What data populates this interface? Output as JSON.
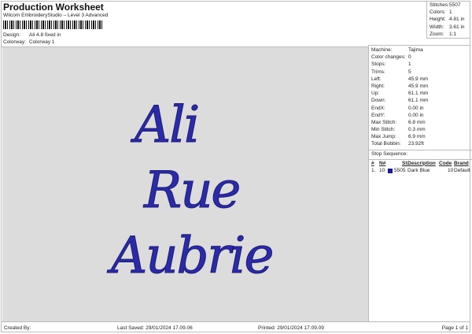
{
  "header": {
    "title": "Production Worksheet",
    "subtitle": "Wilcom EmbroideryStudio – Level 3 Advanced",
    "design_label": "Design:",
    "design_value": "Ali 4.8 fixed in",
    "colorway_label": "Colorway:",
    "colorway_value": "Colorway 1"
  },
  "summary": [
    {
      "label": "Stitches:",
      "value": "5507"
    },
    {
      "label": "Colors:",
      "value": "1"
    },
    {
      "label": "Height:",
      "value": "4.81 in"
    },
    {
      "label": "Width:",
      "value": "3.61 in"
    },
    {
      "label": "Zoom:",
      "value": "1:1"
    }
  ],
  "design": {
    "lines": [
      "Ali",
      "Rue",
      "Aubrie"
    ],
    "thread_color": "#2b2ba8"
  },
  "machine_info": [
    {
      "label": "Machine:",
      "value": "Tajima"
    },
    {
      "label": "Color changes:",
      "value": "0"
    },
    {
      "label": "Stops:",
      "value": "1"
    },
    {
      "label": "Trims:",
      "value": "5"
    },
    {
      "label": "Left:",
      "value": "45.9 mm"
    },
    {
      "label": "Right:",
      "value": "45.9 mm"
    },
    {
      "label": "Up:",
      "value": "61.1 mm"
    },
    {
      "label": "Down:",
      "value": "61.1 mm"
    },
    {
      "label": "EndX:",
      "value": "0.00 in"
    },
    {
      "label": "EndY:",
      "value": "0.00 in"
    },
    {
      "label": "Max Stitch:",
      "value": "6.8 mm"
    },
    {
      "label": "Min Stitch:",
      "value": "0.3 mm"
    },
    {
      "label": "Max Jump:",
      "value": "6.9 mm"
    },
    {
      "label": "Total Bobbin:",
      "value": "23.92ft"
    }
  ],
  "stop_sequence": {
    "title": "Stop Sequence:",
    "columns": [
      "#",
      "N#",
      "St.",
      "Description",
      "Code",
      "Brand"
    ],
    "rows": [
      {
        "num": "1.",
        "n": "10",
        "color": "#1a1aa0",
        "st": "5505",
        "description": "Dark Blue",
        "code": "10",
        "brand": "Default"
      }
    ]
  },
  "footer": {
    "created_by": "Created By:",
    "last_saved": "Last Saved: 29/01/2024 17.09.06",
    "printed": "Printed: 29/01/2024 17.09.09",
    "page": "Page 1 of 1"
  }
}
